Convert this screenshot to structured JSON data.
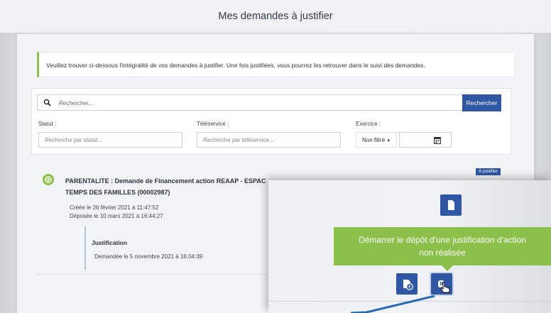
{
  "page": {
    "title": "Mes demandes à justifier"
  },
  "info": {
    "text": "Veuillez trouver ci-dessous l'intégralité de vos demandes à justifier. Une fois justifiées, vous pourrez les retrouver dans le suivi des demandes."
  },
  "search": {
    "placeholder": "Rechercher...",
    "button": "Rechercher"
  },
  "filters": {
    "statut": {
      "label": "Statut :",
      "placeholder": "Recherche par statut..."
    },
    "teleservice": {
      "label": "Téléservice :",
      "placeholder": "Recherche par téléservice..."
    },
    "exercice": {
      "label": "Exercice :",
      "value": "Non filtré",
      "year_value": ""
    }
  },
  "item": {
    "badge": "À justifier",
    "title_line1": "PARENTALITE : Demande de Financement action REAAP - ESPAC",
    "title_line2": "TEMPS DES FAMILLES (00002987)",
    "created": "Créée le 26 février 2021 à 11:47:52",
    "deposited": "Déposée le 10 mars 2021 à 16:44:27",
    "justification_title": "Justification",
    "justification_date": "Demandée le 5 novembre 2021 à 16:04:39"
  },
  "zoom": {
    "tooltip_line1": "Démarrer le dépôt d'une justification d'action",
    "tooltip_line2": "non réalisée"
  },
  "colors": {
    "primary": "#2f57a3",
    "success": "#8bc34a",
    "tooltip": "#8bc14a",
    "arrow": "#2a6ab5"
  },
  "icons": {
    "search": "search-icon",
    "calendar": "calendar-icon",
    "item_status": "check-circle-icon",
    "document": "document-icon",
    "euro_doc": "euro-document-icon",
    "hand": "hand-icon",
    "cursor": "pointer-cursor-icon"
  }
}
